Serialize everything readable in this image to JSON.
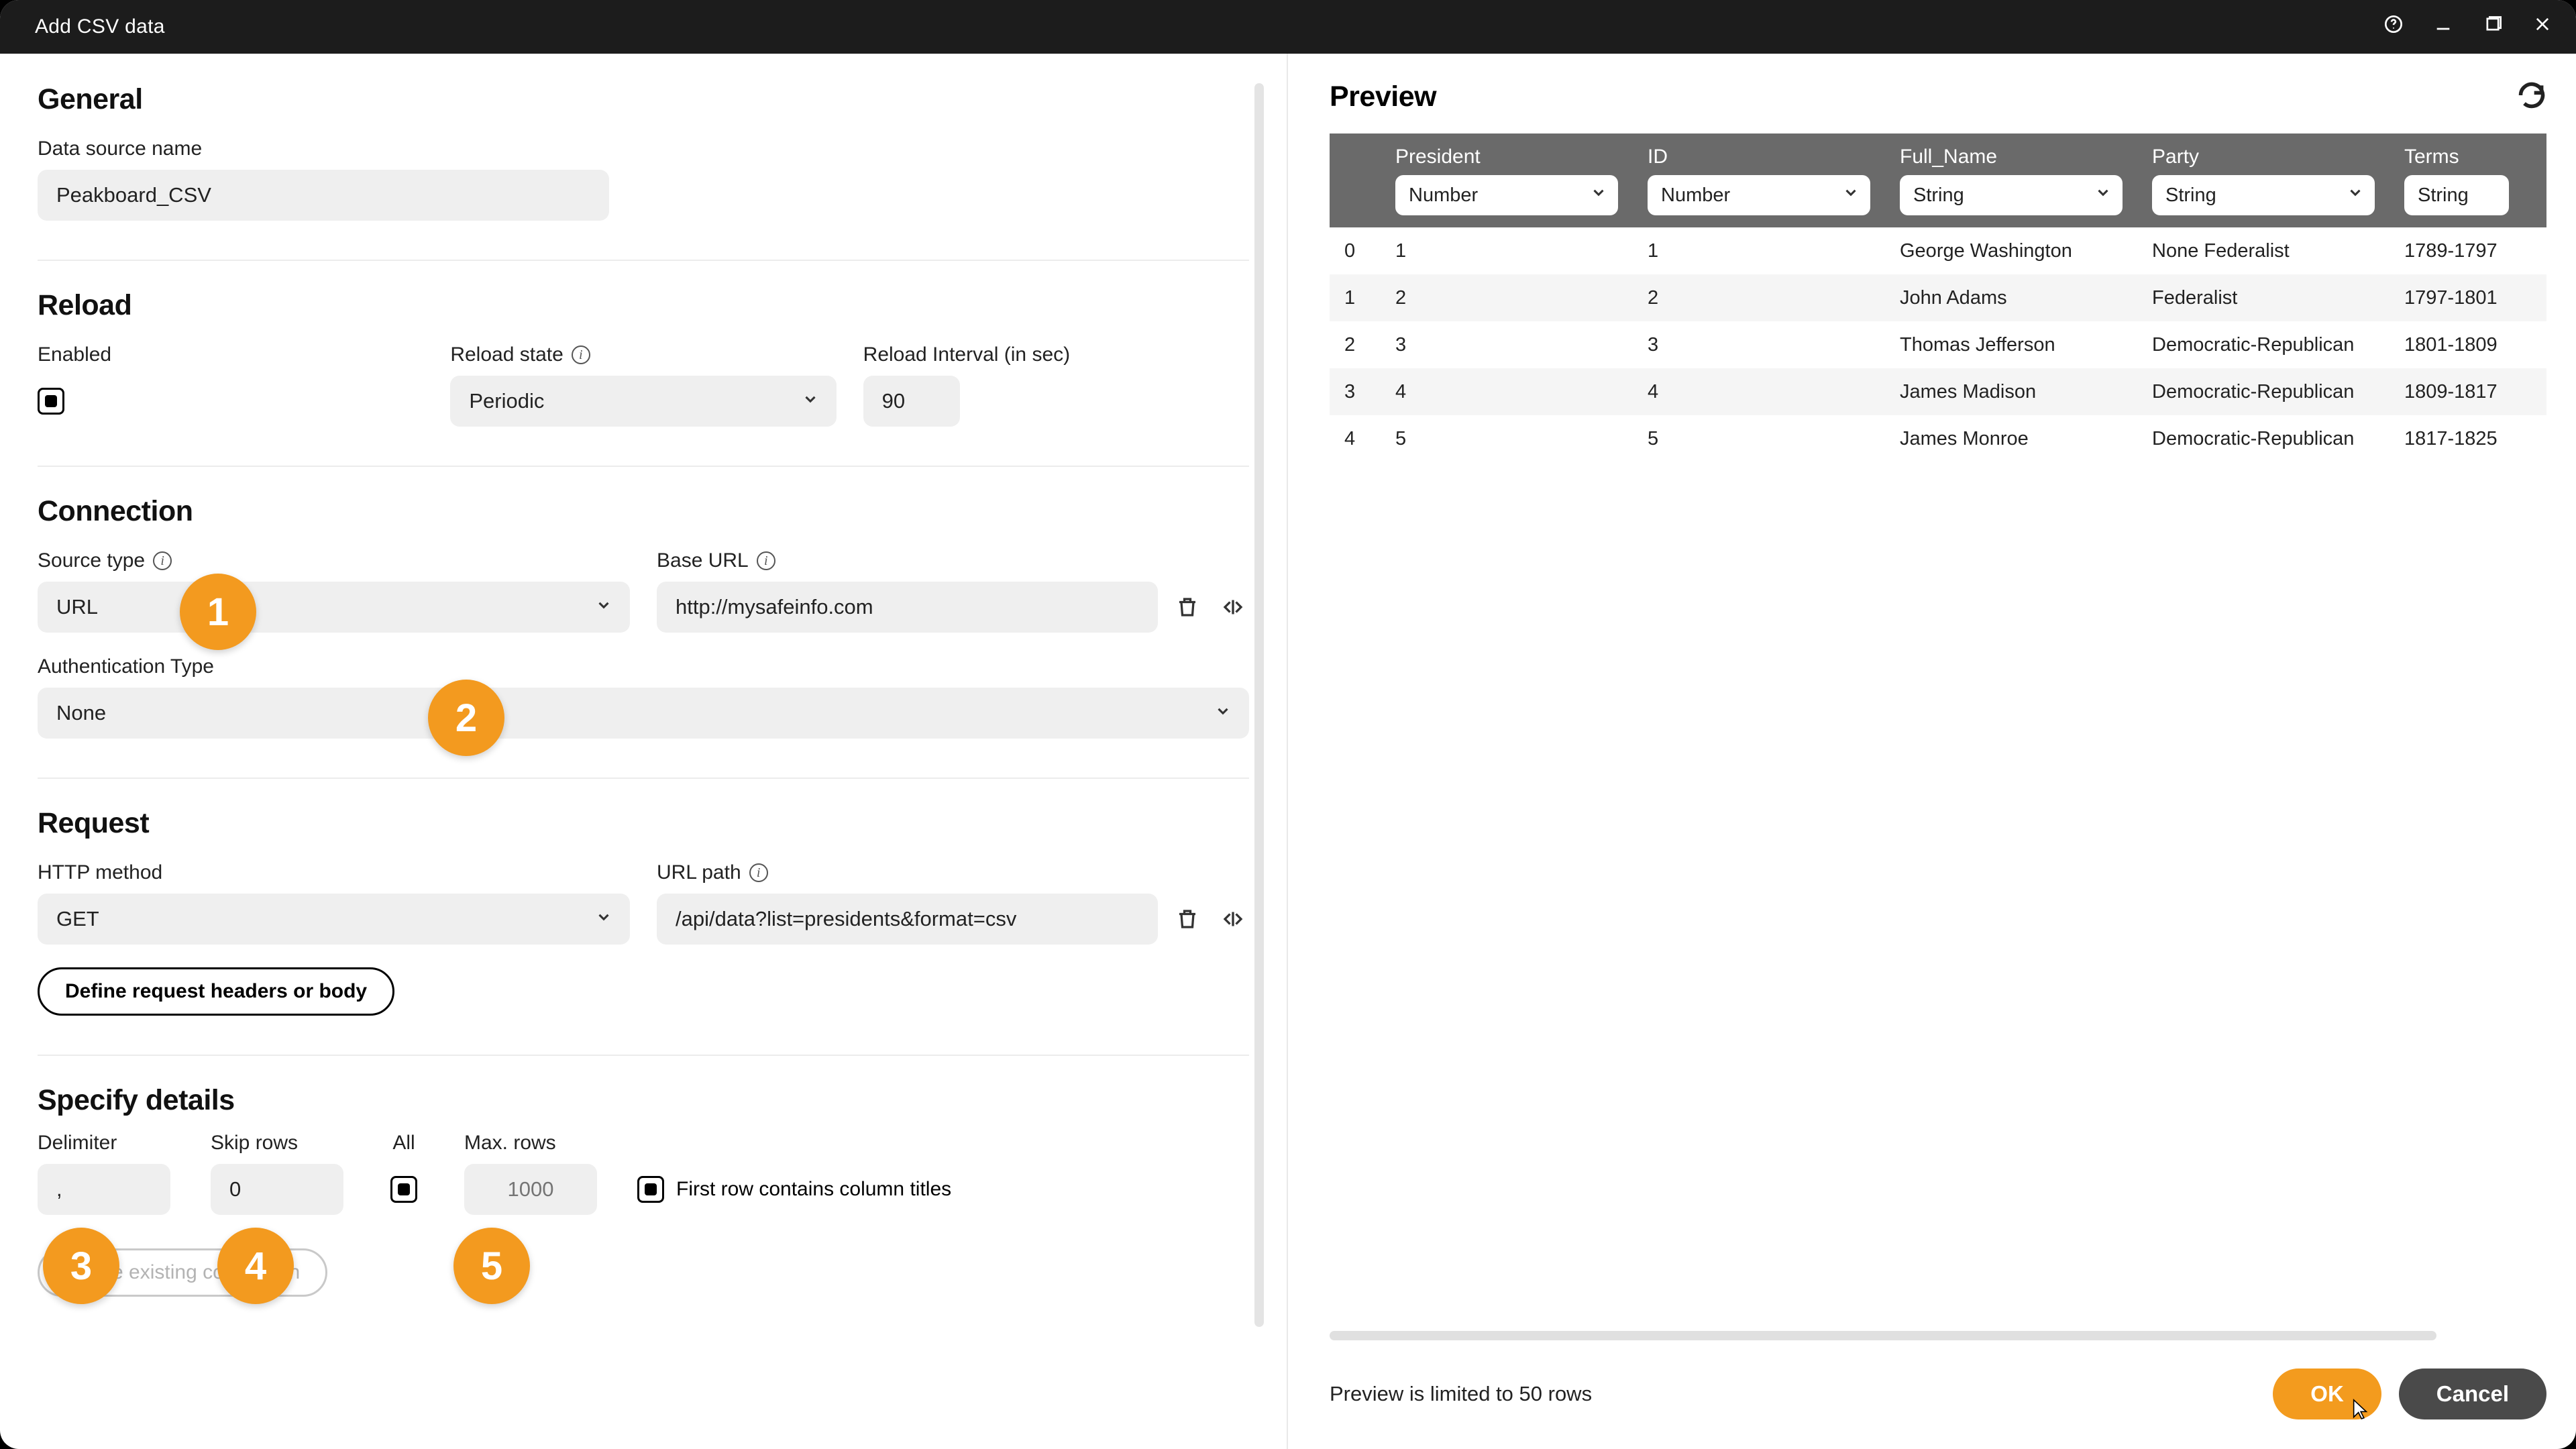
{
  "titlebar": {
    "title": "Add CSV data"
  },
  "general": {
    "heading": "General",
    "data_source_name_label": "Data source name",
    "data_source_name_value": "Peakboard_CSV"
  },
  "reload": {
    "heading": "Reload",
    "enabled_label": "Enabled",
    "reload_state_label": "Reload state",
    "reload_state_value": "Periodic",
    "reload_interval_label": "Reload Interval (in sec)",
    "reload_interval_value": "90"
  },
  "connection": {
    "heading": "Connection",
    "source_type_label": "Source type",
    "source_type_value": "URL",
    "base_url_label": "Base URL",
    "base_url_value": "http://mysafeinfo.com",
    "auth_type_label": "Authentication Type",
    "auth_type_value": "None"
  },
  "request": {
    "heading": "Request",
    "http_method_label": "HTTP method",
    "http_method_value": "GET",
    "url_path_label": "URL path",
    "url_path_value": "/api/data?list=presidents&format=csv",
    "define_headers_label": "Define request headers or body"
  },
  "details": {
    "heading": "Specify details",
    "delimiter_label": "Delimiter",
    "delimiter_value": ",",
    "skip_rows_label": "Skip rows",
    "skip_rows_value": "0",
    "all_label": "All",
    "max_rows_label": "Max. rows",
    "max_rows_placeholder": "1000",
    "first_row_label": "First row contains column titles",
    "reuse_label": "Reuse existing connection"
  },
  "callouts": [
    "1",
    "2",
    "3",
    "4",
    "5"
  ],
  "preview": {
    "heading": "Preview",
    "columns": [
      {
        "name": "President",
        "type": "Number"
      },
      {
        "name": "ID",
        "type": "Number"
      },
      {
        "name": "Full_Name",
        "type": "String"
      },
      {
        "name": "Party",
        "type": "String"
      },
      {
        "name": "Terms",
        "type": "String"
      }
    ],
    "rows": [
      {
        "idx": "0",
        "president": "1",
        "id": "1",
        "full": "George Washington",
        "party": "None Federalist",
        "terms": "1789-1797"
      },
      {
        "idx": "1",
        "president": "2",
        "id": "2",
        "full": "John Adams",
        "party": "Federalist",
        "terms": "1797-1801"
      },
      {
        "idx": "2",
        "president": "3",
        "id": "3",
        "full": "Thomas Jefferson",
        "party": "Democratic-Republican",
        "terms": "1801-1809"
      },
      {
        "idx": "3",
        "president": "4",
        "id": "4",
        "full": "James Madison",
        "party": "Democratic-Republican",
        "terms": "1809-1817"
      },
      {
        "idx": "4",
        "president": "5",
        "id": "5",
        "full": "James Monroe",
        "party": "Democratic-Republican",
        "terms": "1817-1825"
      }
    ],
    "note": "Preview is limited to 50 rows",
    "ok_label": "OK",
    "cancel_label": "Cancel"
  }
}
